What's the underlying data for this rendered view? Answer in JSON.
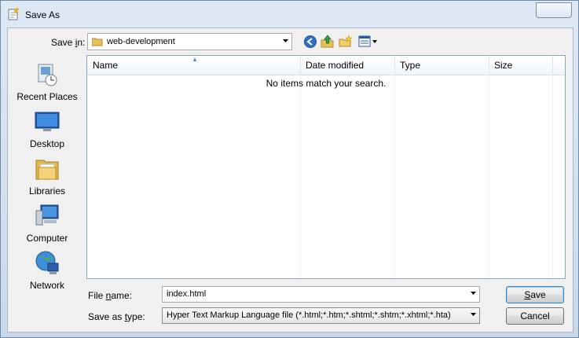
{
  "window": {
    "title": "Save As"
  },
  "toolbar": {
    "save_in_label_pre": "Save ",
    "save_in_label_key": "i",
    "save_in_label_post": "n:",
    "current_folder": "web-development",
    "icons": [
      "back-icon",
      "up-folder-icon",
      "new-folder-icon",
      "view-menu-icon"
    ]
  },
  "places": [
    {
      "label": "Recent Places",
      "icon": "recent-places-icon"
    },
    {
      "label": "Desktop",
      "icon": "desktop-icon"
    },
    {
      "label": "Libraries",
      "icon": "libraries-icon"
    },
    {
      "label": "Computer",
      "icon": "computer-icon"
    },
    {
      "label": "Network",
      "icon": "network-icon"
    }
  ],
  "file_list": {
    "columns": [
      "Name",
      "Date modified",
      "Type",
      "Size"
    ],
    "empty_message": "No items match your search."
  },
  "form": {
    "file_name_label_pre": "File ",
    "file_name_label_key": "n",
    "file_name_label_post": "ame:",
    "file_name_value": "index.html",
    "save_type_label_pre": "Save as ",
    "save_type_label_key": "t",
    "save_type_label_post": "ype:",
    "save_type_value": "Hyper Text Markup Language file (*.html;*.htm;*.shtml;*.shtm;*.xhtml;*.hta)"
  },
  "buttons": {
    "save_key": "S",
    "save_rest": "ave",
    "cancel": "Cancel"
  }
}
